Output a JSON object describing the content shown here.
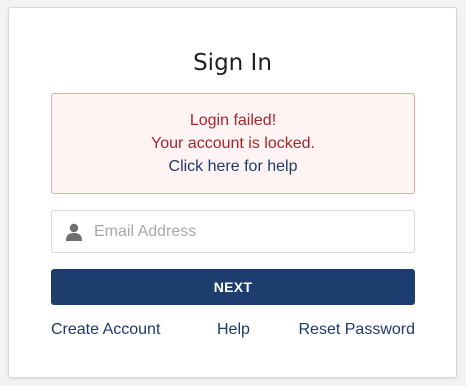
{
  "signin": {
    "title": "Sign In",
    "alert": {
      "line1": "Login failed!",
      "line2": "Your account is locked.",
      "link": "Click here for help"
    },
    "email": {
      "placeholder": "Email Address",
      "value": "",
      "icon": "user-icon"
    },
    "next_label": "NEXT",
    "links": {
      "create_account": "Create Account",
      "help": "Help",
      "reset_password": "Reset Password"
    }
  }
}
